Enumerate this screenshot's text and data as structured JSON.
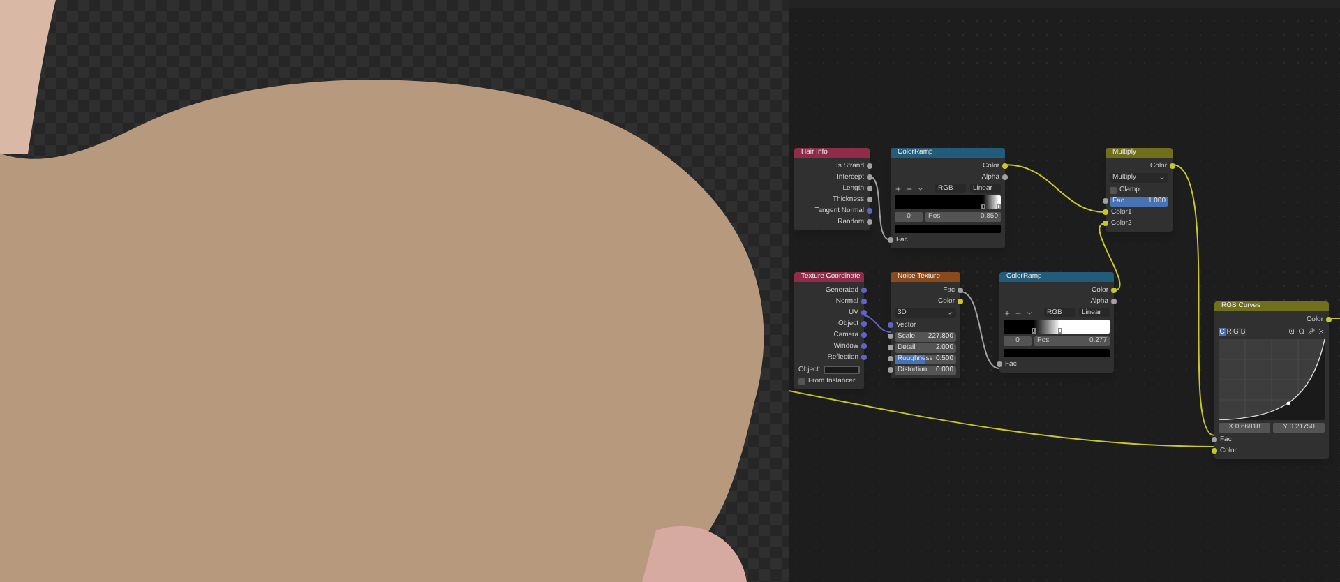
{
  "viewport": {
    "kind": "render"
  },
  "nodes": [
    {
      "title": "Hair Info",
      "color": "#8e2c4a",
      "rows": [
        {
          "kind": "output",
          "label": "Is Strand",
          "color": "#a1a1a1"
        },
        {
          "kind": "output",
          "label": "Intercept",
          "color": "#a1a1a1"
        },
        {
          "kind": "output",
          "label": "Length",
          "color": "#a1a1a1"
        },
        {
          "kind": "output",
          "label": "Thickness",
          "color": "#a1a1a1"
        },
        {
          "kind": "output",
          "label": "Tangent Normal",
          "color": "#6363c7"
        },
        {
          "kind": "output",
          "label": "Random",
          "color": "#a1a1a1"
        }
      ]
    },
    {
      "title": "ColorRamp",
      "color": "#235b7a",
      "rows": [
        {
          "kind": "output",
          "label": "Color",
          "color": "#c7c729"
        },
        {
          "kind": "output",
          "label": "Alpha",
          "color": "#a1a1a1"
        },
        {
          "kind": "ramp_controls",
          "mode": "RGB",
          "interpolation": "Linear"
        },
        {
          "kind": "ramp",
          "stops": [
            {
              "level": 0.83,
              "color": "#000000"
            },
            {
              "level": 0.98,
              "color": "#ffffff"
            }
          ]
        },
        {
          "kind": "ramp_fields",
          "index": "0",
          "label": "Pos",
          "value": "0.850"
        },
        {
          "kind": "swatch",
          "color": "#000000"
        },
        {
          "kind": "input",
          "label": "Fac",
          "color": "#a1a1a1"
        }
      ]
    },
    {
      "title": "Multiply",
      "color": "#6f6f1c",
      "rows": [
        {
          "kind": "output",
          "label": "Color",
          "color": "#c7c729"
        },
        {
          "kind": "dropdown",
          "value": "Multiply"
        },
        {
          "kind": "checkbox",
          "label": "Clamp",
          "checked": false
        },
        {
          "kind": "slider",
          "label": "Fac",
          "value": "1.000",
          "level": 1,
          "color": "#a1a1a1"
        },
        {
          "kind": "input",
          "label": "Color1",
          "color": "#c7c729"
        },
        {
          "kind": "input",
          "label": "Color2",
          "color": "#c7c729"
        }
      ]
    },
    {
      "title": "Texture Coordinate",
      "color": "#8e2c4a",
      "rows": [
        {
          "kind": "output",
          "label": "Generated",
          "color": "#6363c7"
        },
        {
          "kind": "output",
          "label": "Normal",
          "color": "#6363c7"
        },
        {
          "kind": "output",
          "label": "UV",
          "color": "#6363c7"
        },
        {
          "kind": "output",
          "label": "Object",
          "color": "#6363c7"
        },
        {
          "kind": "output",
          "label": "Camera",
          "color": "#6363c7"
        },
        {
          "kind": "output",
          "label": "Window",
          "color": "#6363c7"
        },
        {
          "kind": "output",
          "label": "Reflection",
          "color": "#6363c7"
        },
        {
          "kind": "object_field",
          "label": "Object:"
        },
        {
          "kind": "checkbox",
          "label": "From Instancer",
          "checked": false
        }
      ]
    },
    {
      "title": "Noise Texture",
      "color": "#8a4a1c",
      "rows": [
        {
          "kind": "output",
          "label": "Fac",
          "color": "#a1a1a1"
        },
        {
          "kind": "output",
          "label": "Color",
          "color": "#c7c729"
        },
        {
          "kind": "dropdown",
          "value": "3D"
        },
        {
          "kind": "input",
          "label": "Vector",
          "color": "#6363c7"
        },
        {
          "kind": "slider",
          "label": "Scale",
          "value": "227.800",
          "level": 0,
          "color": "#a1a1a1"
        },
        {
          "kind": "slider",
          "label": "Detail",
          "value": "2.000",
          "level": 0,
          "color": "#a1a1a1"
        },
        {
          "kind": "slider",
          "label": "Roughness",
          "value": "0.500",
          "level": 0.5,
          "color": "#a1a1a1"
        },
        {
          "kind": "slider",
          "label": "Distortion",
          "value": "0.000",
          "level": 0,
          "color": "#a1a1a1"
        }
      ]
    },
    {
      "title": "ColorRamp",
      "color": "#235b7a",
      "rows": [
        {
          "kind": "output",
          "label": "Color",
          "color": "#c7c729"
        },
        {
          "kind": "output",
          "label": "Alpha",
          "color": "#a1a1a1"
        },
        {
          "kind": "ramp_controls",
          "mode": "RGB",
          "interpolation": "Linear"
        },
        {
          "kind": "ramp",
          "stops": [
            {
              "level": 0.28,
              "color": "#000000"
            },
            {
              "level": 0.53,
              "color": "#ffffff"
            }
          ]
        },
        {
          "kind": "ramp_fields",
          "index": "0",
          "label": "Pos",
          "value": "0.277"
        },
        {
          "kind": "swatch",
          "color": "#000000"
        },
        {
          "kind": "input",
          "label": "Fac",
          "color": "#a1a1a1"
        }
      ]
    },
    {
      "title": "RGB Curves",
      "color": "#6f6f1c",
      "rows": [
        {
          "kind": "output",
          "label": "Color",
          "color": "#c7c729"
        },
        {
          "kind": "curve_toolbar",
          "channels": [
            {
              "label": "C",
              "selected": true
            },
            {
              "label": "R",
              "selected": false
            },
            {
              "label": "G",
              "selected": false
            },
            {
              "label": "B",
              "selected": false
            }
          ]
        },
        {
          "kind": "curve"
        },
        {
          "kind": "readout",
          "x": "X 0.66818",
          "y": "Y 0.21750"
        },
        {
          "kind": "input",
          "label": "Fac",
          "color": "#a1a1a1"
        },
        {
          "kind": "input",
          "label": "Color",
          "color": "#c7c729"
        }
      ]
    }
  ]
}
